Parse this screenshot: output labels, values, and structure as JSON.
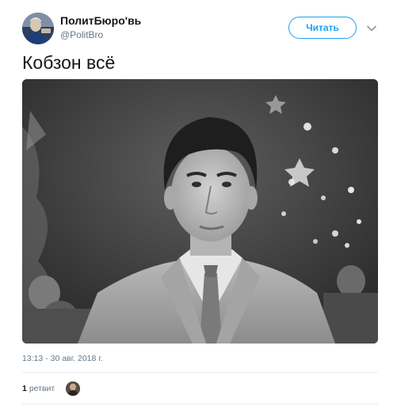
{
  "author": {
    "display_name": "ПолитБюро'вь",
    "handle": "@PolitBro",
    "avatar_icon": "profile-photo-icon"
  },
  "header": {
    "follow_label": "Читать",
    "menu_icon": "chevron-down-icon"
  },
  "tweet": {
    "text": "Кобзон всё",
    "media_icon": "black-and-white-portrait-photo"
  },
  "meta": {
    "timestamp": "13:13 - 30 авг. 2018 г."
  },
  "stats": {
    "retweet_count": "1",
    "retweet_label": "ретвит",
    "retweeter_avatar_icon": "retweeter-avatar-icon"
  },
  "colors": {
    "accent": "#1da1f2",
    "text_primary": "#14171a",
    "text_secondary": "#657786",
    "divider": "#e6ecf0"
  }
}
